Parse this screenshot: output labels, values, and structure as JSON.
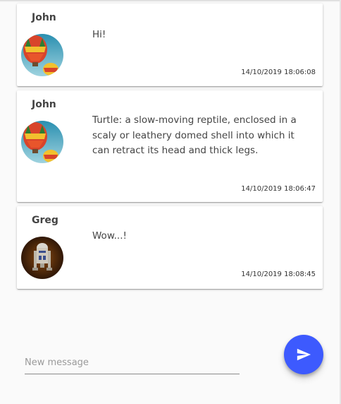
{
  "messages": [
    {
      "author": "John",
      "avatar": "hot-air-balloon-avatar",
      "text": "Hi!",
      "timestamp": "14/10/2019 18:06:08"
    },
    {
      "author": "John",
      "avatar": "hot-air-balloon-avatar",
      "text": "Turtle: a slow-moving reptile, enclosed in a scaly or leathery domed shell into which it can retract its head and thick legs.",
      "timestamp": "14/10/2019 18:06:47"
    },
    {
      "author": "Greg",
      "avatar": "r2d2-robot-avatar",
      "text": "Wow...!",
      "timestamp": "14/10/2019 18:08:45"
    }
  ],
  "composer": {
    "placeholder": "New message",
    "value": "",
    "send_icon": "send-icon"
  },
  "colors": {
    "accent": "#3d5afe",
    "card_background": "#ffffff",
    "page_background": "#fafafa"
  }
}
